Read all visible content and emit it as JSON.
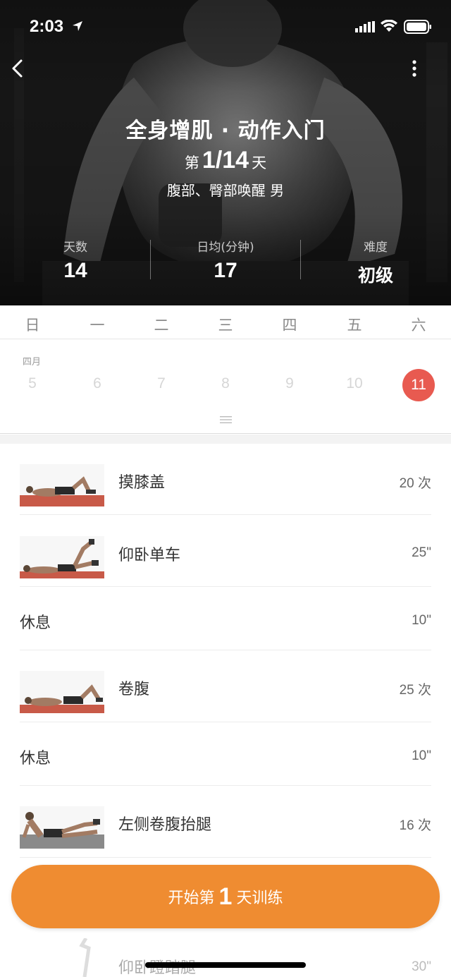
{
  "status_bar": {
    "time": "2:03"
  },
  "hero": {
    "title": "全身增肌 · 动作入门",
    "day_prefix": "第",
    "day_value": "1/14",
    "day_suffix": "天",
    "subtitle": "腹部、臀部唤醒 男",
    "stats": [
      {
        "label": "天数",
        "value": "14"
      },
      {
        "label": "日均(分钟)",
        "value": "17"
      },
      {
        "label": "难度",
        "value": "初级"
      }
    ]
  },
  "calendar": {
    "weekdays": [
      "日",
      "一",
      "二",
      "三",
      "四",
      "五",
      "六"
    ],
    "month_label": "四月",
    "dates": [
      "5",
      "6",
      "7",
      "8",
      "9",
      "10",
      "11"
    ],
    "selected_index": 6
  },
  "exercises": [
    {
      "name": "摸膝盖",
      "amount": "20 次",
      "type": "exercise"
    },
    {
      "name": "仰卧单车",
      "amount": "25\"",
      "type": "exercise"
    },
    {
      "name": "休息",
      "amount": "10\"",
      "type": "rest"
    },
    {
      "name": "卷腹",
      "amount": "25 次",
      "type": "exercise"
    },
    {
      "name": "休息",
      "amount": "10\"",
      "type": "rest"
    },
    {
      "name": "左侧卷腹抬腿",
      "amount": "16 次",
      "type": "exercise"
    }
  ],
  "peek_item": {
    "name": "仰卧蹬踏腿",
    "amount": "30\""
  },
  "start_button": {
    "prefix": "开始第",
    "day": "1",
    "suffix": "天训练"
  },
  "colors": {
    "accent_orange": "#ef8c31",
    "selected_red": "#e85a50",
    "mat_red": "#c85a48"
  }
}
